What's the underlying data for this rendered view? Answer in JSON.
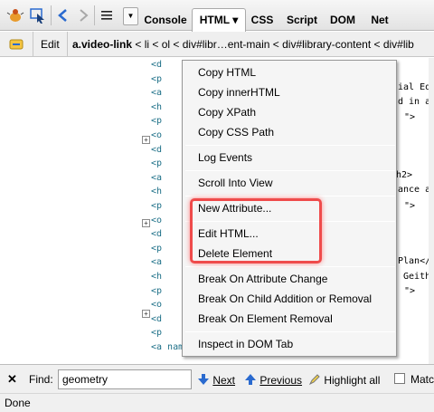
{
  "toolbar": {
    "tabs": [
      "Console",
      "HTML ▾",
      "CSS",
      "Script",
      "DOM",
      "Net"
    ],
    "icons": [
      "firebug-icon",
      "inspect-icon",
      "back-icon",
      "forward-icon",
      "menu-lines-icon",
      "dropdown-arrow-icon"
    ]
  },
  "breadcrumbs": {
    "edit_label": "Edit",
    "current": "a.video-link",
    "rest": " < li < ol < div#libr…ent-main < div#library-content < div#lib"
  },
  "code_lines": [
    "<d",
    "<p",
    "<a",
    "<h",
    "<p",
    "<o",
    "<d",
    "<p",
    "<a",
    "<h",
    "<p",
    "<o",
    "<d",
    "<p",
    "<a",
    "<h",
    "<p",
    "<o",
    "<d",
    "<p",
    "<a name= Geometry >"
  ],
  "code_tails": [
    {
      "text": "ial Eq"
    },
    {
      "text": "d in a"
    },
    {
      "text": "\">"
    },
    {
      "text": "h2>"
    },
    {
      "text": "ance a"
    },
    {
      "text": "\">"
    },
    {
      "text": "Plan</"
    },
    {
      "text": " Geith"
    },
    {
      "text": "\">"
    }
  ],
  "context_menu": {
    "items": [
      "Copy HTML",
      "Copy innerHTML",
      "Copy XPath",
      "Copy CSS Path",
      "Log Events",
      "Scroll Into View",
      "New Attribute...",
      "Edit HTML...",
      "Delete Element",
      "Break On Attribute Change",
      "Break On Child Addition or Removal",
      "Break On Element Removal",
      "Inspect in DOM Tab"
    ]
  },
  "findbar": {
    "close": "✕",
    "find_label": "Find:",
    "find_value": "geometry",
    "next_label": "Next",
    "previous_label": "Previous",
    "highlight_all_label": "Highlight all",
    "match_label": "Matc"
  },
  "status": {
    "text": "Done"
  },
  "colors": {
    "highlight_box": "#ef4b4b",
    "code_tag": "#1c6f87",
    "arrow_blue": "#2a6acf"
  }
}
